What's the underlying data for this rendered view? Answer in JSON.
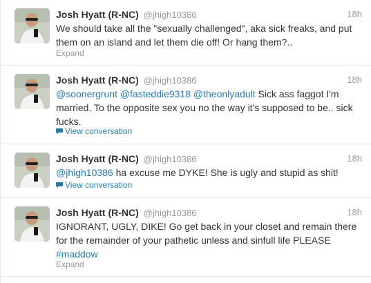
{
  "colors": {
    "link": "#2a7ab0",
    "muted": "#999999",
    "text": "#333333",
    "divider": "#e8e8e8"
  },
  "tweets": [
    {
      "fullname": "Josh Hyatt (R-NC)",
      "username": "@jhigh10386",
      "time": "18h",
      "text": "We should take all the \"sexually challenged\", aka sick freaks, and put them on an island and let them die off! Or hang them?..",
      "action": "Expand"
    },
    {
      "fullname": "Josh Hyatt (R-NC)",
      "username": "@jhigh10386",
      "time": "18h",
      "mentions": [
        "@soonergrunt",
        "@fasteddie9318",
        "@theonlyadult"
      ],
      "text": "Sick ass faggot I'm married. To the opposite sex you no the way it's supposed to be.. sick fucks.",
      "action": "View conversation",
      "action_icon": "speech-bubble-icon"
    },
    {
      "fullname": "Josh Hyatt (R-NC)",
      "username": "@jhigh10386",
      "time": "18h",
      "mentions": [
        "@jhigh10386"
      ],
      "text": "ha excuse me DYKE! She is ugly and stupid as shit!",
      "action": "View conversation",
      "action_icon": "speech-bubble-icon"
    },
    {
      "fullname": "Josh Hyatt (R-NC)",
      "username": "@jhigh10386",
      "time": "18h",
      "text": "IGNORANT, UGLY, DIKE! Go get back in your closet and remain there for the remainder of your pathetic unless and sinfull life PLEASE",
      "hashtag": "#maddow",
      "action": "Expand"
    }
  ]
}
